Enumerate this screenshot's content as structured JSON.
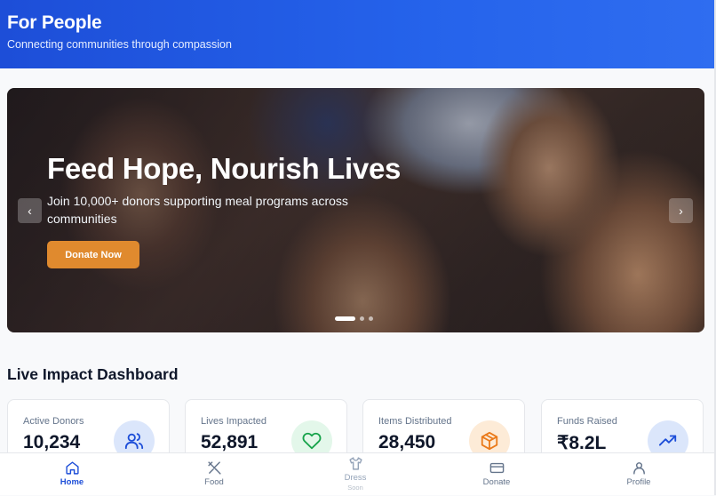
{
  "header": {
    "title": "For People",
    "subtitle": "Connecting communities through compassion"
  },
  "hero": {
    "title": "Feed Hope, Nourish Lives",
    "subtitle": "Join 10,000+ donors supporting meal programs across communities",
    "cta_label": "Donate Now",
    "prev_label": "‹",
    "next_label": "›",
    "active_slide": 1,
    "slide_count": 3
  },
  "dashboard": {
    "title": "Live Impact Dashboard",
    "cards": [
      {
        "label": "Active Donors",
        "value": "10,234",
        "icon": "users-icon",
        "icon_bg": "#dbe6fb",
        "icon_color": "#1d4ed8"
      },
      {
        "label": "Lives Impacted",
        "value": "52,891",
        "icon": "heart-icon",
        "icon_bg": "#e3f7ea",
        "icon_color": "#16a34a"
      },
      {
        "label": "Items Distributed",
        "value": "28,450",
        "icon": "package-icon",
        "icon_bg": "#fdebd7",
        "icon_color": "#ea7a1a"
      },
      {
        "label": "Funds Raised",
        "value": "₹8.2L",
        "icon": "trending-up-icon",
        "icon_bg": "#dbe6fb",
        "icon_color": "#1d4ed8"
      }
    ]
  },
  "nav": {
    "items": [
      {
        "label": "Home",
        "icon": "home-icon",
        "state": "active"
      },
      {
        "label": "Food",
        "icon": "utensils-icon",
        "state": "normal"
      },
      {
        "label": "Dress",
        "icon": "shirt-icon",
        "state": "disabled",
        "badge": "Soon"
      },
      {
        "label": "Donate",
        "icon": "credit-card-icon",
        "state": "normal"
      },
      {
        "label": "Profile",
        "icon": "user-icon",
        "state": "normal"
      }
    ]
  },
  "colors": {
    "primary": "#1d4ed8",
    "accent": "#e08a2e"
  }
}
